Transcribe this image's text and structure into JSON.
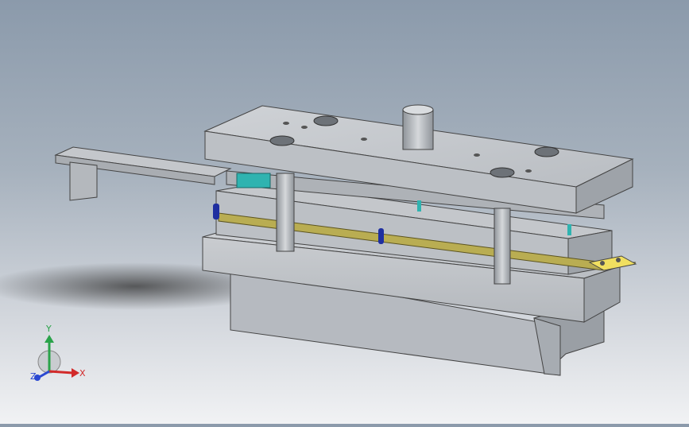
{
  "triad": {
    "x_label": "X",
    "y_label": "Y",
    "z_label": "Z",
    "x_color": "#d22a2a",
    "y_color": "#2aa34a",
    "z_color": "#2a48d2"
  },
  "model": {
    "plate_color": "#c8cbcf",
    "plate_shade": "#9ea3a9",
    "accent_teal": "#2fb3b0",
    "strip_color": "#b9ad52",
    "marker_blue": "#1f2fa0",
    "tag_yellow": "#f0df60"
  }
}
